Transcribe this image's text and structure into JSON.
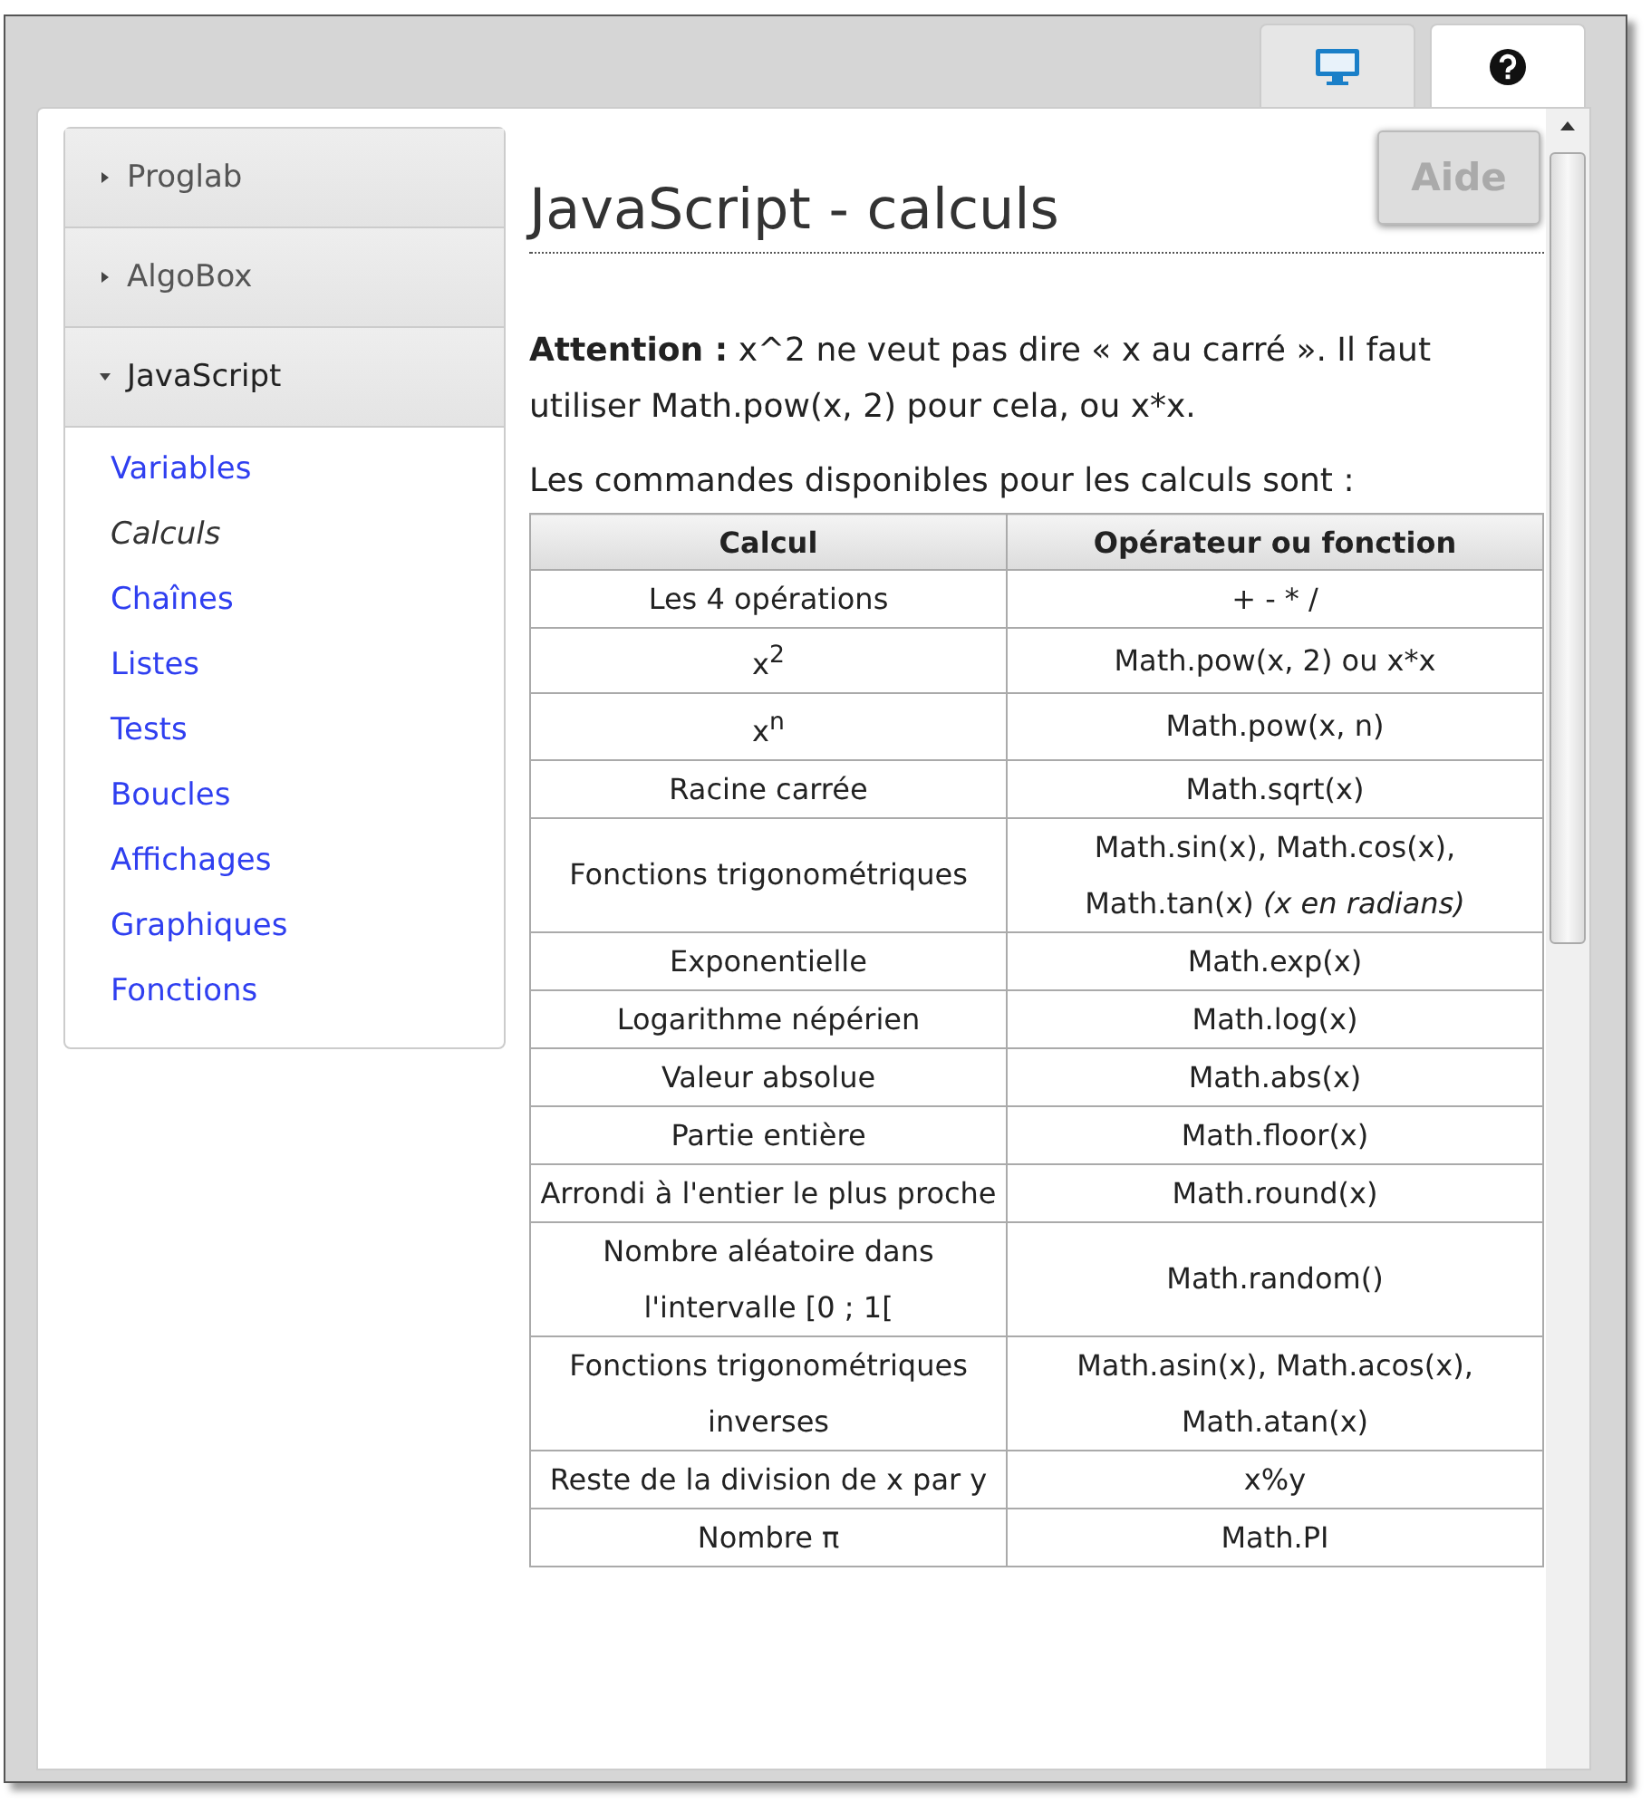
{
  "tabs": [
    {
      "kind": "monitor",
      "selected": false
    },
    {
      "kind": "help",
      "selected": true
    }
  ],
  "help_button": {
    "label": "Aide",
    "disabled": true
  },
  "sidebar": {
    "sections": [
      {
        "label": "Proglab",
        "expanded": false
      },
      {
        "label": "AlgoBox",
        "expanded": false
      },
      {
        "label": "JavaScript",
        "expanded": true,
        "items": [
          {
            "label": "Variables",
            "selected": false
          },
          {
            "label": "Calculs",
            "selected": true
          },
          {
            "label": "Chaînes",
            "selected": false
          },
          {
            "label": "Listes",
            "selected": false
          },
          {
            "label": "Tests",
            "selected": false
          },
          {
            "label": "Boucles",
            "selected": false
          },
          {
            "label": "Affichages",
            "selected": false
          },
          {
            "label": "Graphiques",
            "selected": false
          },
          {
            "label": "Fonctions",
            "selected": false
          }
        ]
      }
    ]
  },
  "content": {
    "title": "JavaScript - calculs",
    "paragraphs": [
      "**Attention :** x^2 ne veut pas dire « x au carré ». Il faut utiliser Math.pow(x, 2) pour cela, ou x*x.",
      "Les commandes disponibles pour les calculs sont :"
    ],
    "table": {
      "columns": [
        "Calcul",
        "Opérateur ou fonction"
      ],
      "rows": [
        [
          "Les 4 opérations",
          "+ - * /"
        ],
        [
          "x$^{2}$",
          "Math.pow(x, 2) ou x*x"
        ],
        [
          "x$^{n}$",
          "Math.pow(x, n)"
        ],
        [
          "Racine carrée",
          "Math.sqrt(x)"
        ],
        [
          "Fonctions trigonométriques",
          "Math.sin(x), Math.cos(x), Math.tan(x) *(x en radians)*"
        ],
        [
          "Exponentielle",
          "Math.exp(x)"
        ],
        [
          "Logarithme népérien",
          "Math.log(x)"
        ],
        [
          "Valeur absolue",
          "Math.abs(x)"
        ],
        [
          "Partie entière",
          "Math.floor(x)"
        ],
        [
          "Arrondi à l'entier le plus proche",
          "Math.round(x)"
        ],
        [
          "Nombre aléatoire dans l'intervalle [0 ; 1[",
          "Math.random()"
        ],
        [
          "Fonctions trigonométriques inverses",
          "Math.asin(x), Math.acos(x), Math.atan(x)"
        ],
        [
          "Reste de la division de x par y",
          "x%y"
        ],
        [
          "Nombre π",
          "Math.PI"
        ]
      ]
    }
  }
}
